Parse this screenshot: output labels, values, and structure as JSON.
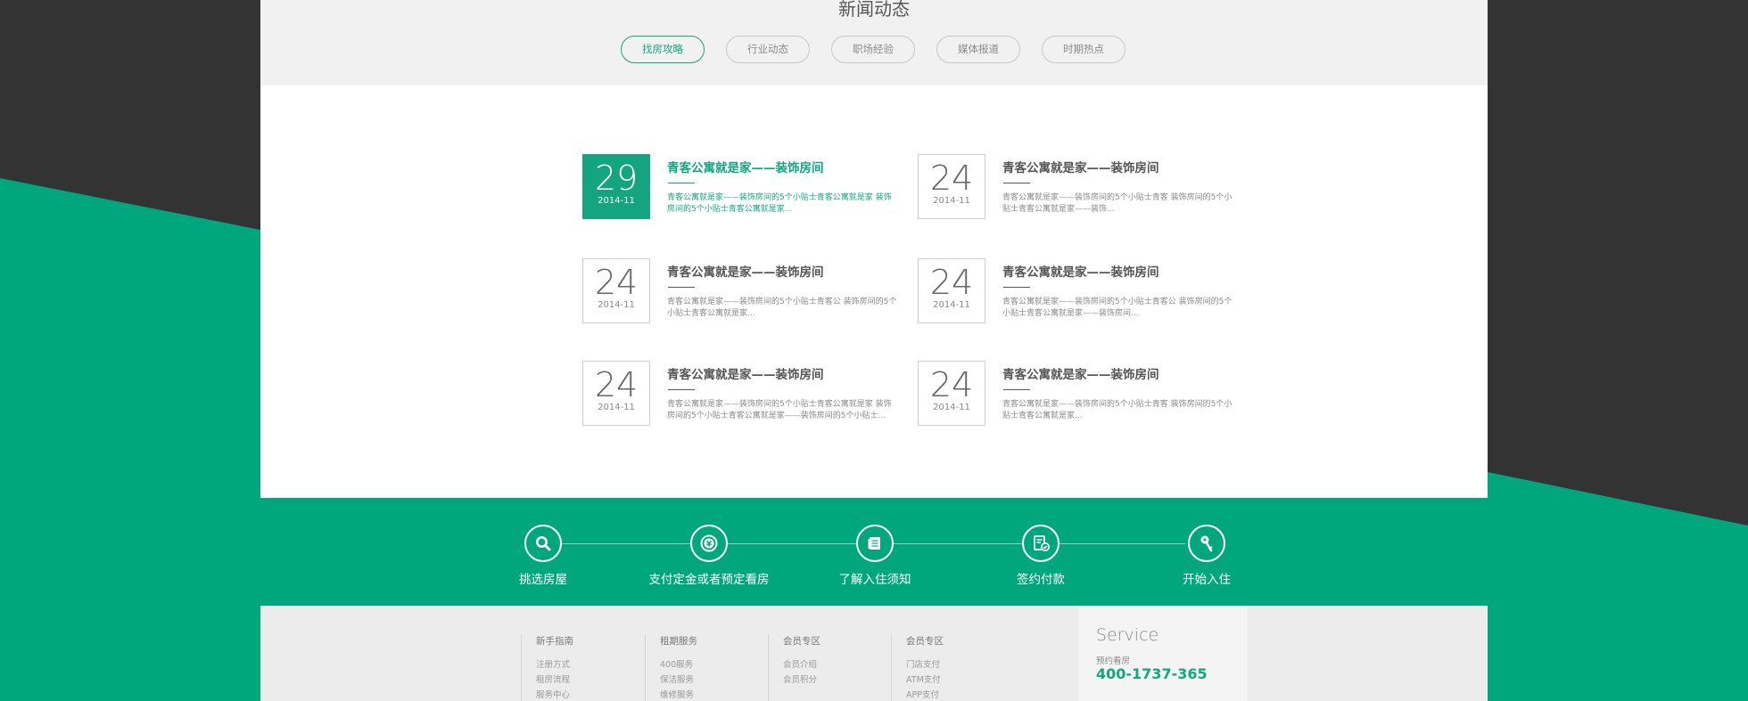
{
  "news": {
    "title": "新闻动态",
    "tabs": [
      {
        "label": "找房攻略"
      },
      {
        "label": "行业动态"
      },
      {
        "label": "职场经验"
      },
      {
        "label": "媒体报道"
      },
      {
        "label": "时期热点"
      }
    ],
    "items": [
      {
        "day": "29",
        "ym": "2014-11",
        "title": "青客公寓就是家——装饰房间",
        "desc": "青客公寓就是家——装饰房间的5个小贴士青客公寓就是家 装饰房间的5个小贴士青客公寓就是家..."
      },
      {
        "day": "24",
        "ym": "2014-11",
        "title": "青客公寓就是家——装饰房间",
        "desc": "青客公寓就是家——装饰房间的5个小贴士青客 装饰房间的5个小贴士青客公寓就是家——装饰..."
      },
      {
        "day": "24",
        "ym": "2014-11",
        "title": "青客公寓就是家——装饰房间",
        "desc": "青客公寓就是家——装饰房间的5个小贴士青客公 装饰房间的5个小贴士青客公寓就是家..."
      },
      {
        "day": "24",
        "ym": "2014-11",
        "title": "青客公寓就是家——装饰房间",
        "desc": "青客公寓就是家——装饰房间的5个小贴士青客公 装饰房间的5个小贴士青客公寓就是家——装饰房间..."
      },
      {
        "day": "24",
        "ym": "2014-11",
        "title": "青客公寓就是家——装饰房间",
        "desc": "青客公寓就是家——装饰房间的5个小贴士青客公寓就是家 装饰房间的5个小贴士青客公寓就是家——装饰房间的5个小贴士..."
      },
      {
        "day": "24",
        "ym": "2014-11",
        "title": "青客公寓就是家——装饰房间",
        "desc": "青客公寓就是家——装饰房间的5个小贴士青客 装饰房间的5个小贴士青客公寓就是家..."
      }
    ]
  },
  "steps": [
    {
      "label": "挑选房屋",
      "icon": "search-icon"
    },
    {
      "label": "支付定金或者预定看房",
      "icon": "coin-icon"
    },
    {
      "label": "了解入住须知",
      "icon": "document-icon"
    },
    {
      "label": "签约付款",
      "icon": "contract-check-icon"
    },
    {
      "label": "开始入住",
      "icon": "key-icon"
    }
  ],
  "footer": {
    "columns": [
      {
        "title": "新手指南",
        "links": [
          "注册方式",
          "租房流程",
          "服务中心"
        ]
      },
      {
        "title": "租期服务",
        "links": [
          "400服务",
          "保洁服务",
          "维修服务"
        ]
      },
      {
        "title": "会员专区",
        "links": [
          "会员介绍",
          "会员积分"
        ]
      },
      {
        "title": "会员专区",
        "links": [
          "门店支付",
          "ATM支付",
          "APP支付"
        ]
      }
    ],
    "service": {
      "title": "Service",
      "subtitle": "预约看房",
      "phone": "400-1737-365"
    }
  },
  "colors": {
    "accent": "#00a77d",
    "dark_bg": "#333333"
  }
}
